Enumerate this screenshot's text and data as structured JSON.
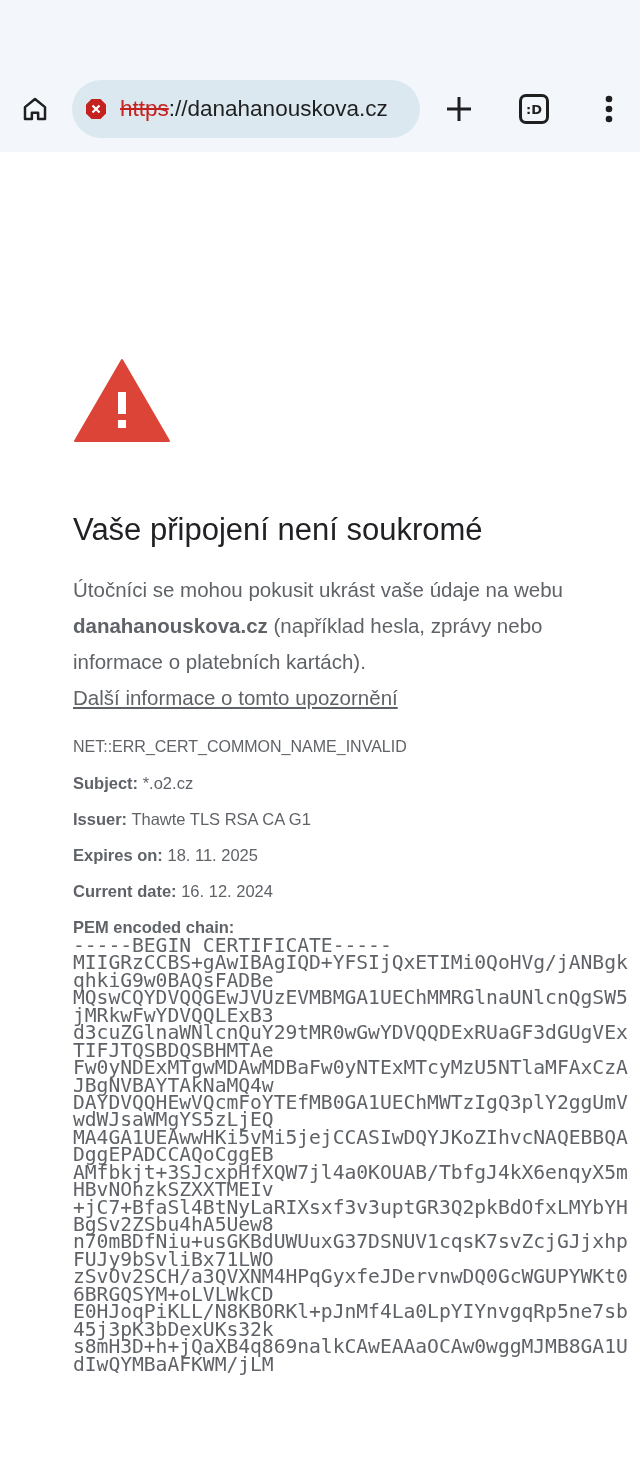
{
  "toolbar": {
    "url_scheme": "https",
    "url_rest": "://danahanouskova.cz",
    "tab_count": ":D"
  },
  "error_page": {
    "title": "Vaše připojení není soukromé",
    "message": "Útočníci se mohou pokusit ukrást vaše údaje na webu **danahanouskova.cz** (například hesla, zprávy nebo informace o platebních kartách).",
    "learn_more_link": "Další informace o tomto upozornění",
    "error_code": "NET::ERR_CERT_COMMON_NAME_INVALID",
    "details": [
      {
        "label": "Subject:",
        "value": "*.o2.cz"
      },
      {
        "label": "Issuer:",
        "value": "Thawte TLS RSA CA G1"
      },
      {
        "label": "Expires on:",
        "value": "18. 11. 2025"
      },
      {
        "label": "Current date:",
        "value": "16. 12. 2024"
      }
    ],
    "pem_label": "PEM encoded chain:",
    "pem_lines": [
      "-----BEGIN CERTIFICATE-----",
      "MIIGRzCCBS+gAwIBAgIQD+YFSIjQxETIMi0QoHVg/jANBgk",
      "qhkiG9w0BAQsFADBe",
      "MQswCQYDVQQGEwJVUzEVMBMGA1UEChMMRGlnaUNlcnQgSW5",
      "jMRkwFwYDVQQLExB3",
      "d3cuZGlnaWNlcnQuY29tMR0wGwYDVQQDExRUaGF3dGUgVEx",
      "TIFJTQSBDQSBHMTAe",
      "Fw0yNDExMTgwMDAwMDBaFw0yNTExMTcyMzU5NTlaMFAxCzA",
      "JBgNVBAYTAkNaMQ4w",
      "DAYDVQQHEwVQcmFoYTEfMB0GA1UEChMWTzIgQ3plY2ggUmV",
      "wdWJsaWMgYS5zLjEQ",
      "MA4GA1UEAwwHKi5vMi5jejCCASIwDQYJKoZIhvcNAQEBBQA",
      "DggEPADCCAQoCggEB",
      "AMfbkjt+3SJcxpHfXQW7jl4a0KOUAB/TbfgJ4kX6enqyX5m",
      "HBvNOhzkSZXXTMEIv",
      "+jC7+BfaSl4BtNyLaRIXsxf3v3uptGR3Q2pkBdOfxLMYbYH",
      "BgSv2ZSbu4hA5Uew8",
      "n70mBDfNiu+usGKBdUWUuxG37DSNUV1cqsK7svZcjGJjxhp",
      "FUJy9bSvliBx71LWO",
      "zSvOv2SCH/a3QVXNM4HPqGyxfeJDervnwDQ0GcWGUPYWKt0",
      "6BRGQSYM+oLVLWkCD",
      "E0HJoqPiKLL/N8KBORKl+pJnMf4La0LpYIYnvgqRp5ne7sb",
      "45j3pK3bDexUKs32k",
      "s8mH3D+h+jQaXB4q869nalkCAwEAAaOCAw0wggMJMB8GA1U",
      "dIwQYMBaAFKWM/jLM"
    ]
  }
}
